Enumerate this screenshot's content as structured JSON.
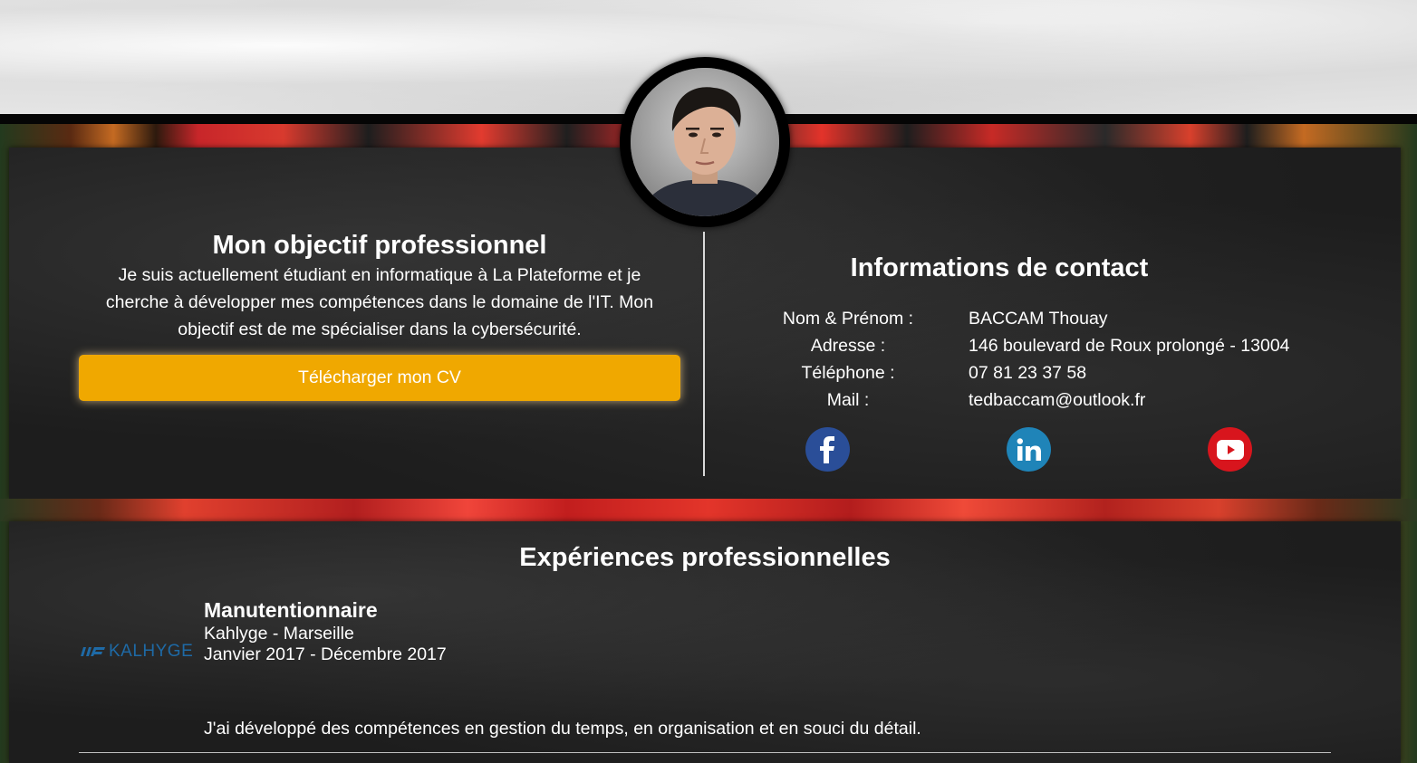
{
  "objective": {
    "title": "Mon objectif professionnel",
    "text": "Je suis actuellement étudiant en informatique à La Plateforme et je cherche à développer mes compétences dans le domaine de l'IT. Mon objectif est de me spécialiser dans la cybersécurité.",
    "cv_button": "Télécharger mon CV"
  },
  "contact": {
    "title": "Informations de contact",
    "rows": [
      {
        "label": "Nom & Prénom :",
        "value": "BACCAM Thouay"
      },
      {
        "label": "Adresse :",
        "value": "146 boulevard de Roux prolongé - 13004"
      },
      {
        "label": "Téléphone :",
        "value": "07 81 23 37 58"
      },
      {
        "label": "Mail :",
        "value": "tedbaccam@outlook.fr"
      }
    ],
    "social": [
      {
        "name": "facebook-icon",
        "glyph": "f",
        "color": "#2a4e98"
      },
      {
        "name": "linkedin-icon",
        "glyph": "in",
        "color": "#1f84b8"
      },
      {
        "name": "youtube-icon",
        "glyph": "play",
        "color": "#d8151d"
      }
    ]
  },
  "experience": {
    "title": "Expériences professionnelles",
    "items": [
      {
        "logo_text": "KALHYGE",
        "role": "Manutentionnaire",
        "company": "Kahlyge - Marseille",
        "dates": "Janvier 2017 - Décembre 2017",
        "description": "J'ai développé des compétences en gestion du temps, en organisation et en souci du détail."
      }
    ]
  },
  "colors": {
    "accent_button": "#f0a800",
    "panel": "#1d1d1d",
    "text": "#ffffff"
  }
}
